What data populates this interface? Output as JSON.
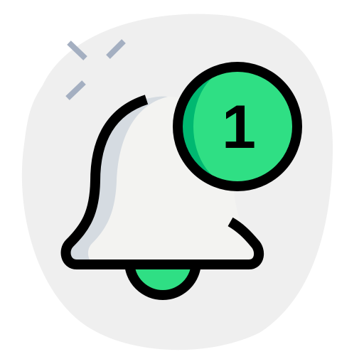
{
  "icon": {
    "name": "notification-bell-icon",
    "badge": {
      "count": "1"
    }
  },
  "colors": {
    "blob": "#efefef",
    "bell_fill": "#f3f3f1",
    "bell_shadow": "#d5dbe1",
    "accent": "#2fdf84",
    "accent_shade": "#00b871",
    "outline": "#000000",
    "sparkle": "#a4afc1"
  }
}
